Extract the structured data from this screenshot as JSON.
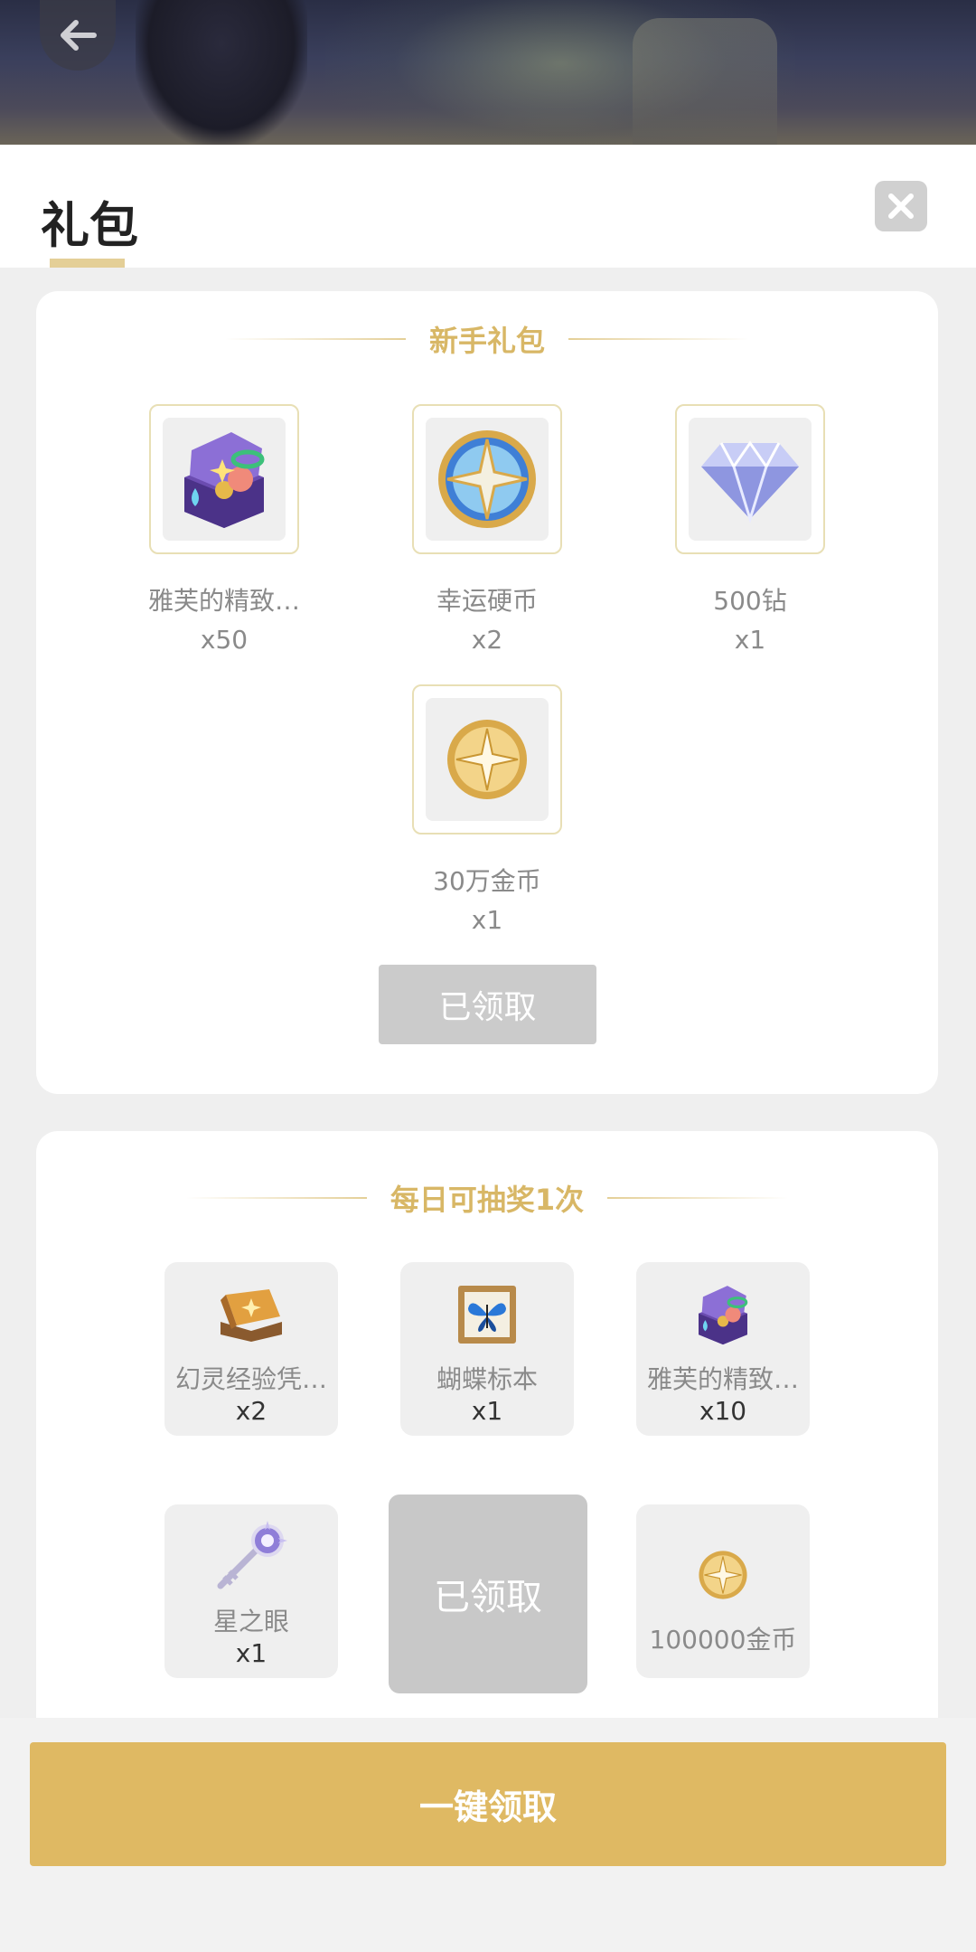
{
  "header": {
    "title": "礼包"
  },
  "newbie": {
    "title": "新手礼包",
    "items": [
      {
        "name": "雅芙的精致…",
        "qty": "x50",
        "icon": "treasure-chest-icon"
      },
      {
        "name": "幸运硬币",
        "qty": "x2",
        "icon": "lucky-coin-icon"
      },
      {
        "name": "500钻",
        "qty": "x1",
        "icon": "diamond-icon"
      },
      {
        "name": "30万金币",
        "qty": "x1",
        "icon": "gold-coin-icon"
      }
    ],
    "button": "已领取"
  },
  "daily": {
    "title": "每日可抽奖1次",
    "items": [
      {
        "name": "幻灵经验凭…",
        "qty": "x2",
        "icon": "exp-book-icon"
      },
      {
        "name": "蝴蝶标本",
        "qty": "x1",
        "icon": "butterfly-specimen-icon"
      },
      {
        "name": "雅芙的精致…",
        "qty": "x10",
        "icon": "treasure-chest-icon"
      },
      {
        "name": "星之眼",
        "qty": "x1",
        "icon": "star-key-icon"
      },
      {
        "name": "100000金币",
        "qty": "",
        "icon": "gold-coin-icon"
      }
    ],
    "claimed": "已领取"
  },
  "footer": {
    "claim_all": "一键领取"
  },
  "colors": {
    "accent": "#dfb963",
    "title_gold": "#d8b766",
    "claimed_gray": "#cbcbcb"
  }
}
